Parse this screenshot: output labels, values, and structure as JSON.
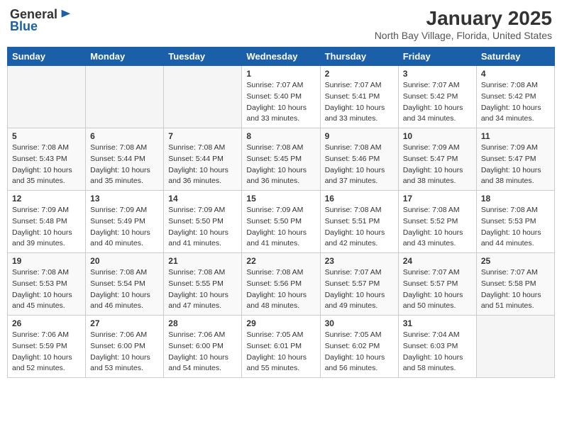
{
  "header": {
    "logo_line1": "General",
    "logo_line2": "Blue",
    "title": "January 2025",
    "subtitle": "North Bay Village, Florida, United States"
  },
  "weekdays": [
    "Sunday",
    "Monday",
    "Tuesday",
    "Wednesday",
    "Thursday",
    "Friday",
    "Saturday"
  ],
  "weeks": [
    [
      {
        "day": "",
        "info": ""
      },
      {
        "day": "",
        "info": ""
      },
      {
        "day": "",
        "info": ""
      },
      {
        "day": "1",
        "info": "Sunrise: 7:07 AM\nSunset: 5:40 PM\nDaylight: 10 hours\nand 33 minutes."
      },
      {
        "day": "2",
        "info": "Sunrise: 7:07 AM\nSunset: 5:41 PM\nDaylight: 10 hours\nand 33 minutes."
      },
      {
        "day": "3",
        "info": "Sunrise: 7:07 AM\nSunset: 5:42 PM\nDaylight: 10 hours\nand 34 minutes."
      },
      {
        "day": "4",
        "info": "Sunrise: 7:08 AM\nSunset: 5:42 PM\nDaylight: 10 hours\nand 34 minutes."
      }
    ],
    [
      {
        "day": "5",
        "info": "Sunrise: 7:08 AM\nSunset: 5:43 PM\nDaylight: 10 hours\nand 35 minutes."
      },
      {
        "day": "6",
        "info": "Sunrise: 7:08 AM\nSunset: 5:44 PM\nDaylight: 10 hours\nand 35 minutes."
      },
      {
        "day": "7",
        "info": "Sunrise: 7:08 AM\nSunset: 5:44 PM\nDaylight: 10 hours\nand 36 minutes."
      },
      {
        "day": "8",
        "info": "Sunrise: 7:08 AM\nSunset: 5:45 PM\nDaylight: 10 hours\nand 36 minutes."
      },
      {
        "day": "9",
        "info": "Sunrise: 7:08 AM\nSunset: 5:46 PM\nDaylight: 10 hours\nand 37 minutes."
      },
      {
        "day": "10",
        "info": "Sunrise: 7:09 AM\nSunset: 5:47 PM\nDaylight: 10 hours\nand 38 minutes."
      },
      {
        "day": "11",
        "info": "Sunrise: 7:09 AM\nSunset: 5:47 PM\nDaylight: 10 hours\nand 38 minutes."
      }
    ],
    [
      {
        "day": "12",
        "info": "Sunrise: 7:09 AM\nSunset: 5:48 PM\nDaylight: 10 hours\nand 39 minutes."
      },
      {
        "day": "13",
        "info": "Sunrise: 7:09 AM\nSunset: 5:49 PM\nDaylight: 10 hours\nand 40 minutes."
      },
      {
        "day": "14",
        "info": "Sunrise: 7:09 AM\nSunset: 5:50 PM\nDaylight: 10 hours\nand 41 minutes."
      },
      {
        "day": "15",
        "info": "Sunrise: 7:09 AM\nSunset: 5:50 PM\nDaylight: 10 hours\nand 41 minutes."
      },
      {
        "day": "16",
        "info": "Sunrise: 7:08 AM\nSunset: 5:51 PM\nDaylight: 10 hours\nand 42 minutes."
      },
      {
        "day": "17",
        "info": "Sunrise: 7:08 AM\nSunset: 5:52 PM\nDaylight: 10 hours\nand 43 minutes."
      },
      {
        "day": "18",
        "info": "Sunrise: 7:08 AM\nSunset: 5:53 PM\nDaylight: 10 hours\nand 44 minutes."
      }
    ],
    [
      {
        "day": "19",
        "info": "Sunrise: 7:08 AM\nSunset: 5:53 PM\nDaylight: 10 hours\nand 45 minutes."
      },
      {
        "day": "20",
        "info": "Sunrise: 7:08 AM\nSunset: 5:54 PM\nDaylight: 10 hours\nand 46 minutes."
      },
      {
        "day": "21",
        "info": "Sunrise: 7:08 AM\nSunset: 5:55 PM\nDaylight: 10 hours\nand 47 minutes."
      },
      {
        "day": "22",
        "info": "Sunrise: 7:08 AM\nSunset: 5:56 PM\nDaylight: 10 hours\nand 48 minutes."
      },
      {
        "day": "23",
        "info": "Sunrise: 7:07 AM\nSunset: 5:57 PM\nDaylight: 10 hours\nand 49 minutes."
      },
      {
        "day": "24",
        "info": "Sunrise: 7:07 AM\nSunset: 5:57 PM\nDaylight: 10 hours\nand 50 minutes."
      },
      {
        "day": "25",
        "info": "Sunrise: 7:07 AM\nSunset: 5:58 PM\nDaylight: 10 hours\nand 51 minutes."
      }
    ],
    [
      {
        "day": "26",
        "info": "Sunrise: 7:06 AM\nSunset: 5:59 PM\nDaylight: 10 hours\nand 52 minutes."
      },
      {
        "day": "27",
        "info": "Sunrise: 7:06 AM\nSunset: 6:00 PM\nDaylight: 10 hours\nand 53 minutes."
      },
      {
        "day": "28",
        "info": "Sunrise: 7:06 AM\nSunset: 6:00 PM\nDaylight: 10 hours\nand 54 minutes."
      },
      {
        "day": "29",
        "info": "Sunrise: 7:05 AM\nSunset: 6:01 PM\nDaylight: 10 hours\nand 55 minutes."
      },
      {
        "day": "30",
        "info": "Sunrise: 7:05 AM\nSunset: 6:02 PM\nDaylight: 10 hours\nand 56 minutes."
      },
      {
        "day": "31",
        "info": "Sunrise: 7:04 AM\nSunset: 6:03 PM\nDaylight: 10 hours\nand 58 minutes."
      },
      {
        "day": "",
        "info": ""
      }
    ]
  ]
}
